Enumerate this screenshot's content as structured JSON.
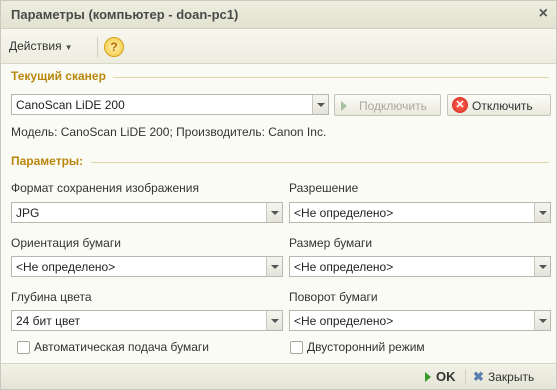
{
  "window": {
    "title": "Параметры (компьютер - doan-pc1)",
    "close_symbol": "×"
  },
  "toolbar": {
    "actions_label": "Действия",
    "help_label": "?"
  },
  "scanner_section": {
    "title": "Текущий сканер",
    "scanner_value": "CanoScan LiDE 200",
    "connect_label": "Подключить",
    "disconnect_label": "Отключить",
    "model_info": "Модель: CanoScan LiDE 200; Производитель: Canon Inc."
  },
  "params_section": {
    "title": "Параметры:",
    "image_format_label": "Формат сохранения изображения",
    "image_format_value": "JPG",
    "resolution_label": "Разрешение",
    "resolution_value": "<Не определено>",
    "orientation_label": "Ориентация бумаги",
    "orientation_value": "<Не определено>",
    "paper_size_label": "Размер бумаги",
    "paper_size_value": "<Не определено>",
    "color_depth_label": "Глубина цвета",
    "color_depth_value": "24 бит цвет",
    "rotation_label": "Поворот бумаги",
    "rotation_value": "<Не определено>",
    "auto_feed_label": "Автоматическая подача бумаги",
    "duplex_label": "Двусторонний режим"
  },
  "footer": {
    "ok_label": "OK",
    "close_label": "Закрыть"
  }
}
